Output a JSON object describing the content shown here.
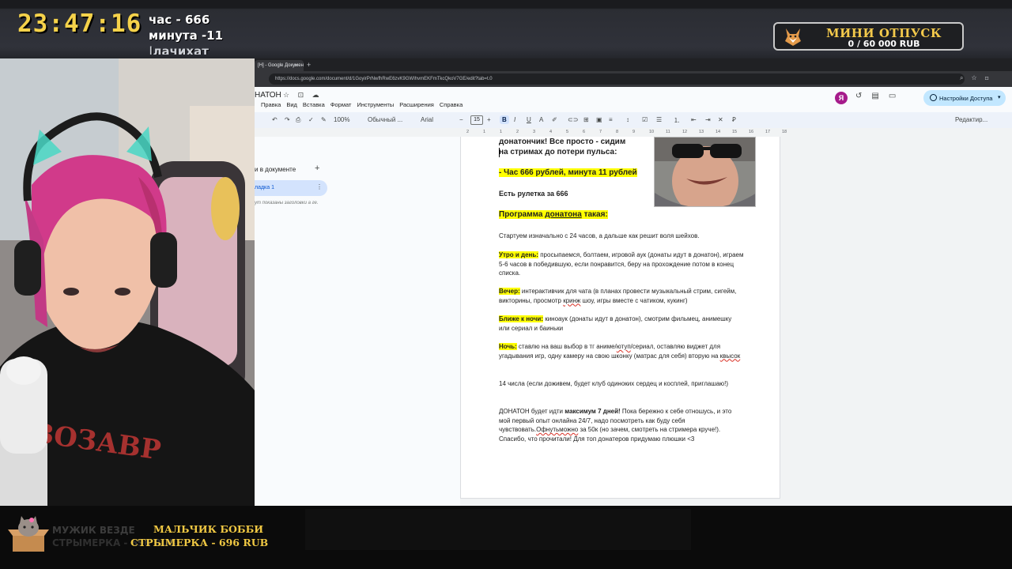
{
  "stream": {
    "clock": "23:47:16",
    "timer_lines": [
      "час - 666",
      "минута -11",
      "|лачихат"
    ],
    "goal": {
      "title": "МИНИ ОТПУСК",
      "amount": "0 / 60 000 RUB",
      "progress": 0.0,
      "fill_color": "#c9a43d"
    },
    "donation_alert": {
      "name": "МАЛЬЧИК БОББИ",
      "amount": "СТРЫМЕРКА - 696 RUB",
      "ghost_name": "МУЖИК ВЕЗДЕ",
      "ghost_amount": "СТРЫМЕРКА - 696 RUB",
      "color": "#f0c843"
    }
  },
  "browser": {
    "tab_title": "[Н] - Google Докумен",
    "tab_close": "×",
    "new_tab": "+",
    "url": "https://docs.google.com/document/d/1GoyirPrNwfhRwE6zvK9GWIhvmEKFmTkcQkoV7GE/edit?tab=t.0",
    "url_icons": "⌕ ☆ ⊡"
  },
  "docs": {
    "title": "НАТОН",
    "title_icons": "☆ ⊡ ☁",
    "menu": [
      "Правка",
      "Вид",
      "Вставка",
      "Формат",
      "Инструменты",
      "Расширения",
      "Справка"
    ],
    "avatar_letter": "Я",
    "share_label": "Настройки Доступа",
    "share_caret": "▾",
    "toolbar": {
      "zoom": "100%",
      "style": "Обычный ...",
      "font": "Arial",
      "font_size": "15",
      "bold": "B",
      "italic": "I",
      "underline": "U",
      "editing": "Редактир..."
    },
    "ruler_ticks": [
      "2",
      "1",
      "1",
      "2",
      "3",
      "4",
      "5",
      "6",
      "7",
      "8",
      "9",
      "10",
      "11",
      "12",
      "13",
      "14",
      "15",
      "16",
      "17",
      "18"
    ],
    "sidebar": {
      "heading": "и в документе",
      "plus": "+",
      "tab_item": "ладка 1",
      "tab_menu": "⋮",
      "hint": "ут показаны заголовки а ге."
    }
  },
  "document": {
    "line1": "донатончик! Все просто - сидим",
    "line2": "на стримах до потери пульса:",
    "price": "- Час 666 рублей, минута 11 рублей",
    "roulette": "Есть рулетка за 666",
    "program_a": "Программа ",
    "program_b": "донатона",
    "program_c": " такая:",
    "start": " Стартуем изначально с 24 часов, а дальше как решит воля шейхов.",
    "morning_label": "Утро и день:",
    "morning_text": " просыпаемся, болтаем, игровой аук (донаты идут в донатон), играем 5-6 часов в победившую, если понравится, беру на прохождение потом в конец списка.",
    "evening_label": "Вечер:",
    "evening_a": " интерактивчик для чата (в планах провести музыкальный стрим, сигейм, викторины, просмотр ",
    "evening_sq": "кринж",
    "evening_b": " шоу, игры вместе с чатиком, кукинг)",
    "closer_label": "Ближе к ночи:",
    "closer_text": " киноаук (донаты идут в донатон), смотрим фильмец, анимешку или сериал и баиньки",
    "night_label": "Ночь:",
    "night_a": "  ставлю на ваш выбор в тг аниме/",
    "night_sq1": "ютуп",
    "night_b": "/сериал, оставляю виджет для угадывания игр, одну камеру на свою шконку (матрас для себя) вторую на ",
    "night_sq2": "квысок",
    "club": "14 числа (если доживем, будет клуб одиноких сердец и косплей, приглашаю!)",
    "final_a": "ДОНАТОН будет идти ",
    "final_bold": "максимум 7 дней!",
    "final_b": " Пока бережно к себе отношусь, и это мой первый опыт онлайна 24/7, надо посмотреть как буду себя чувствовать.",
    "final_sq": "Офнутьможно",
    "final_c": " за 50к (но зачем, смотреть на стримера круче!). Спасибо, что прочитали! Для топ донатеров придумаю плюшки <3"
  },
  "colors": {
    "highlight": "#ffff00",
    "clock": "#f5d24a",
    "share_button": "#c2e7ff",
    "avatar": "#a61b8b"
  }
}
